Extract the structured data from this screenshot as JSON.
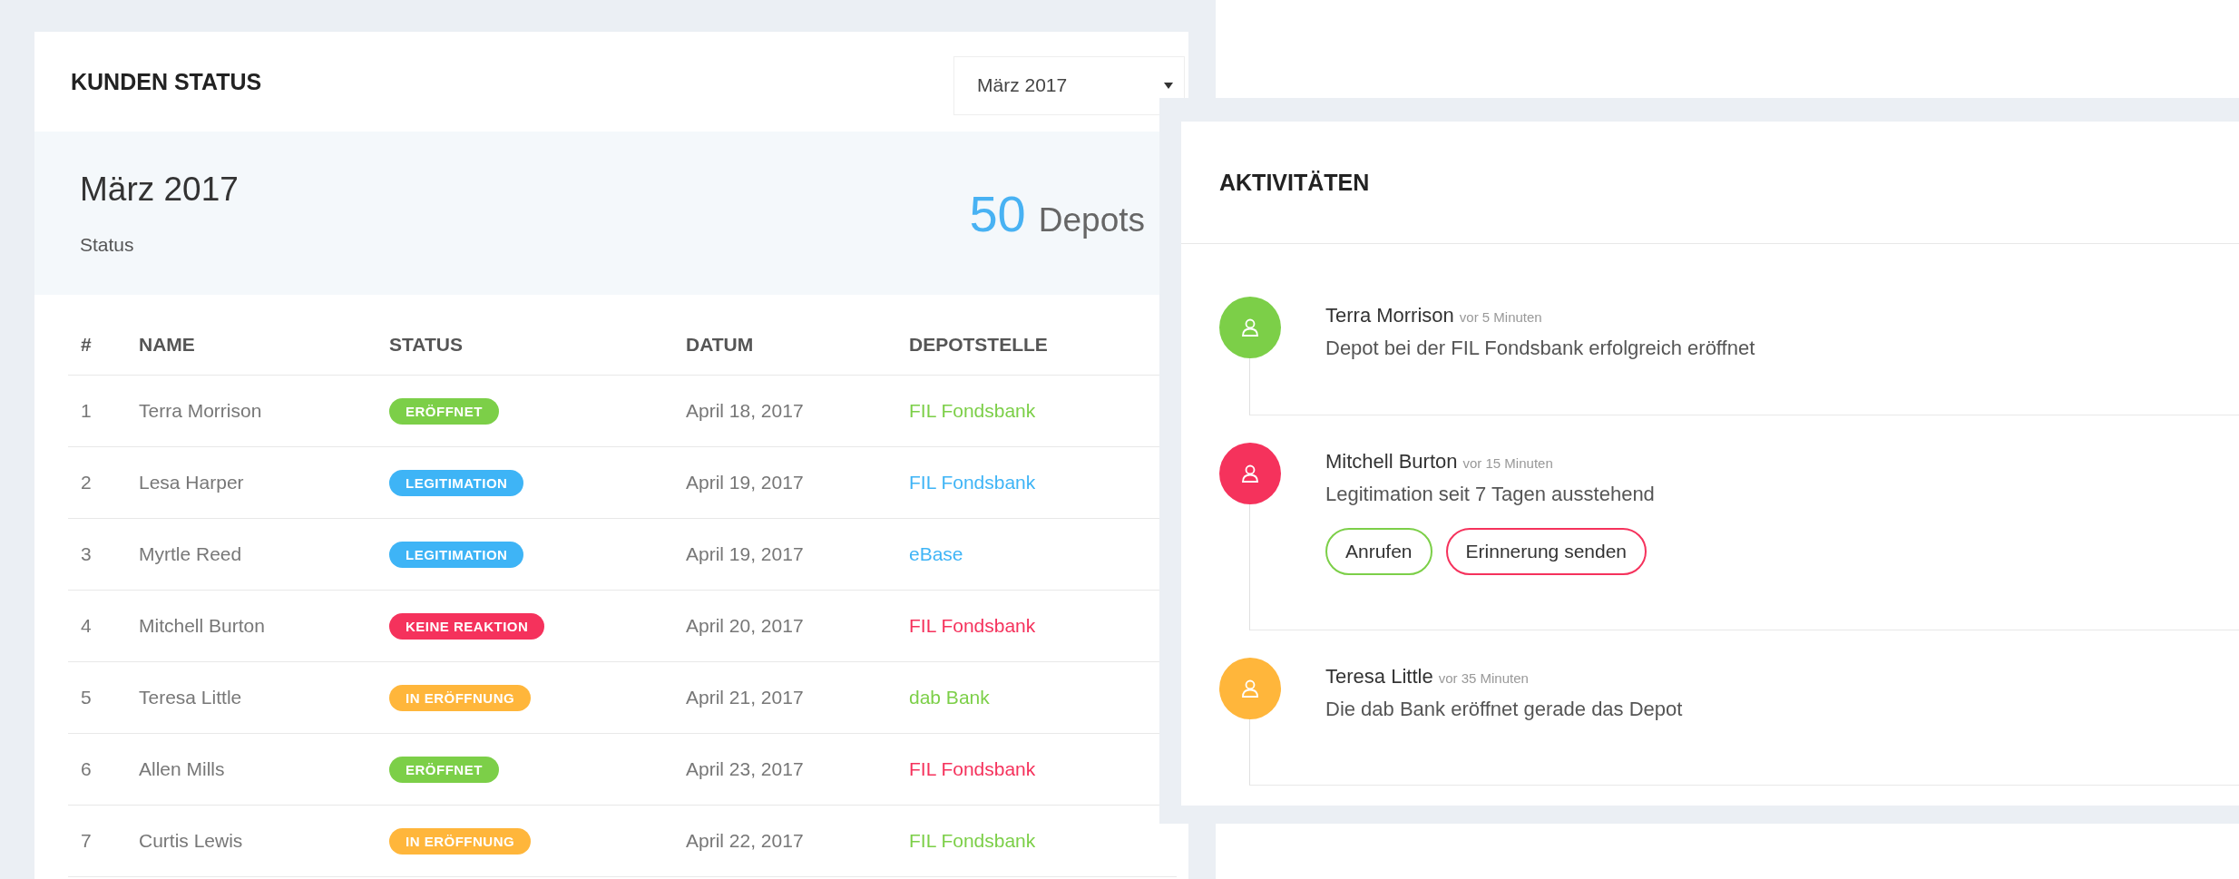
{
  "kunden_status": {
    "title": "KUNDEN STATUS",
    "month_select": {
      "value": "März 2017"
    },
    "summary": {
      "month": "März 2017",
      "label": "Status",
      "count": "50",
      "unit": "Depots"
    },
    "table": {
      "columns": [
        "#",
        "NAME",
        "STATUS",
        "DATUM",
        "DEPOTSTELLE"
      ],
      "rows": [
        {
          "number": "1",
          "name": "Terra Morrison",
          "status": {
            "label": "ERÖFFNET",
            "color": "#7ccf48"
          },
          "date": "April 18, 2017",
          "depot": {
            "label": "FIL Fondsbank",
            "color": "#7ccf48"
          }
        },
        {
          "number": "2",
          "name": "Lesa Harper",
          "status": {
            "label": "LEGITIMATION",
            "color": "#3eb4f6"
          },
          "date": "April 19, 2017",
          "depot": {
            "label": "FIL Fondsbank",
            "color": "#3eb4f6"
          }
        },
        {
          "number": "3",
          "name": "Myrtle Reed",
          "status": {
            "label": "LEGITIMATION",
            "color": "#3eb4f6"
          },
          "date": "April 19, 2017",
          "depot": {
            "label": "eBase",
            "color": "#3eb4f6"
          }
        },
        {
          "number": "4",
          "name": "Mitchell Burton",
          "status": {
            "label": "KEINE REAKTION",
            "color": "#f5325c"
          },
          "date": "April 20, 2017",
          "depot": {
            "label": "FIL Fondsbank",
            "color": "#f5325c"
          }
        },
        {
          "number": "5",
          "name": "Teresa Little",
          "status": {
            "label": "IN ERÖFFNUNG",
            "color": "#ffb63b"
          },
          "date": "April 21, 2017",
          "depot": {
            "label": "dab Bank",
            "color": "#7ccf48"
          }
        },
        {
          "number": "6",
          "name": "Allen Mills",
          "status": {
            "label": "ERÖFFNET",
            "color": "#7ccf48"
          },
          "date": "April 23, 2017",
          "depot": {
            "label": "FIL Fondsbank",
            "color": "#f5325c"
          }
        },
        {
          "number": "7",
          "name": "Curtis Lewis",
          "status": {
            "label": "IN ERÖFFNUNG",
            "color": "#ffb63b"
          },
          "date": "April 22, 2017",
          "depot": {
            "label": "FIL Fondsbank",
            "color": "#7ccf48"
          }
        }
      ]
    }
  },
  "aktivitaeten": {
    "title": "AKTIVITÄTEN",
    "items": [
      {
        "name": "Terra Morrison",
        "time": "vor 5 Minuten",
        "message": "Depot bei der FIL Fondsbank erfolgreich eröffnet",
        "color": "#7ccf48"
      },
      {
        "name": "Mitchell Burton",
        "time": "vor 15 Minuten",
        "message": "Legitimation seit 7 Tagen ausstehend",
        "color": "#f5325c",
        "buttons": [
          {
            "label": "Anrufen",
            "color": "#7ccf48"
          },
          {
            "label": "Erinnerung senden",
            "color": "#f5325c"
          }
        ]
      },
      {
        "name": "Teresa Little",
        "time": "vor 35 Minuten",
        "message": "Die dab Bank eröffnet gerade das Depot",
        "color": "#ffb63b"
      }
    ]
  }
}
